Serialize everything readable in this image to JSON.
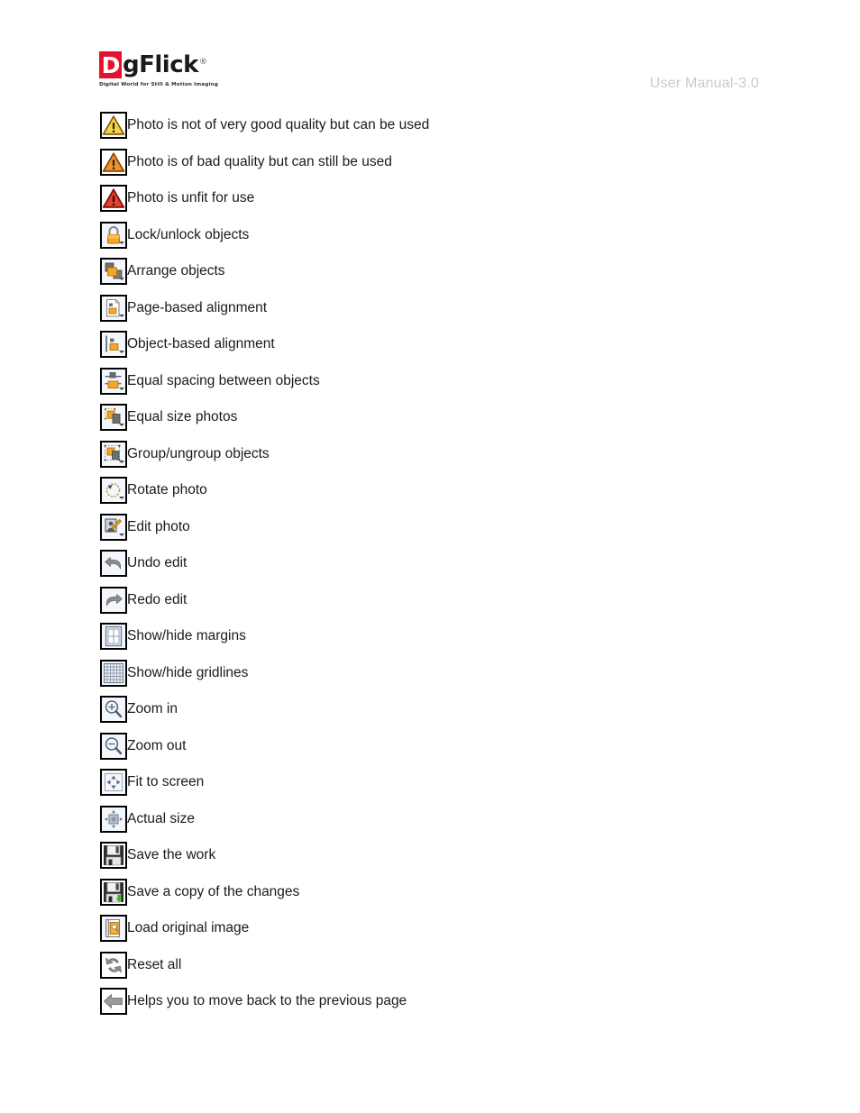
{
  "header": {
    "logo": {
      "initial": "D",
      "wordmark": "gFlick",
      "registered": "®",
      "tagline": "Digital World for Still & Motion Imaging"
    },
    "manual_version": "User Manual-3.0"
  },
  "colors": {
    "brand_red": "#e8112d",
    "warn_yellow": "#f2c230",
    "warn_orange": "#e8801a",
    "warn_red": "#d92b1c",
    "accent_orange": "#f5a623",
    "icon_gray": "#7b7b7b",
    "text": "#1b1b1b",
    "muted": "#c9c9c9"
  },
  "legend": {
    "rows": [
      {
        "icon": "warning-triangle-yellow-icon",
        "label": "Photo is not of very good quality but can be used"
      },
      {
        "icon": "warning-triangle-orange-icon",
        "label": "Photo is of bad quality but can still be used"
      },
      {
        "icon": "warning-triangle-red-icon",
        "label": "Photo is unfit for use"
      },
      {
        "icon": "lock-icon",
        "label": "Lock/unlock objects"
      },
      {
        "icon": "arrange-objects-icon",
        "label": "Arrange objects"
      },
      {
        "icon": "page-alignment-icon",
        "label": "Page-based alignment"
      },
      {
        "icon": "object-alignment-icon",
        "label": "Object-based alignment"
      },
      {
        "icon": "equal-spacing-icon",
        "label": "Equal spacing between objects"
      },
      {
        "icon": "equal-size-icon",
        "label": "Equal size photos"
      },
      {
        "icon": "group-ungroup-icon",
        "label": "Group/ungroup objects"
      },
      {
        "icon": "rotate-photo-icon",
        "label": "Rotate photo"
      },
      {
        "icon": "edit-photo-icon",
        "label": "Edit photo"
      },
      {
        "icon": "undo-icon",
        "label": "Undo edit"
      },
      {
        "icon": "redo-icon",
        "label": "Redo edit"
      },
      {
        "icon": "margins-icon",
        "label": "Show/hide margins"
      },
      {
        "icon": "gridlines-icon",
        "label": "Show/hide gridlines"
      },
      {
        "icon": "zoom-in-icon",
        "label": "Zoom in"
      },
      {
        "icon": "zoom-out-icon",
        "label": "Zoom out"
      },
      {
        "icon": "fit-to-screen-icon",
        "label": "Fit to screen"
      },
      {
        "icon": "actual-size-icon",
        "label": "Actual size"
      },
      {
        "icon": "save-icon",
        "label": "Save the work"
      },
      {
        "icon": "save-copy-icon",
        "label": "Save a copy of the changes"
      },
      {
        "icon": "load-original-icon",
        "label": "Load original image"
      },
      {
        "icon": "reset-all-icon",
        "label": "Reset all"
      },
      {
        "icon": "back-arrow-icon",
        "label": "Helps you to move back to the previous page"
      }
    ]
  }
}
